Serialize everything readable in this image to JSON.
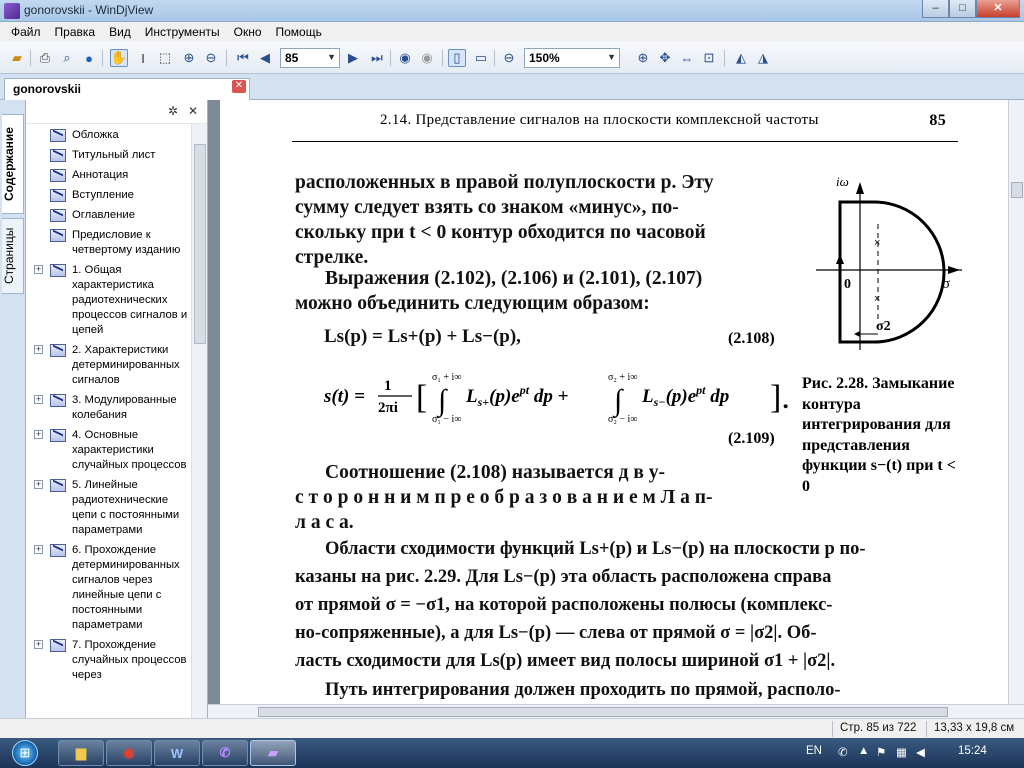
{
  "window": {
    "title": "gonorovskii - WinDjView"
  },
  "menu": [
    "Файл",
    "Правка",
    "Вид",
    "Инструменты",
    "Окно",
    "Помощь"
  ],
  "toolbar": {
    "page_value": "85",
    "zoom_value": "150%"
  },
  "doc_tab": {
    "label": "gonorovskii"
  },
  "side_tabs": {
    "contents": "Содержание",
    "pages": "Страницы"
  },
  "toc": [
    {
      "label": "Обложка",
      "expandable": false
    },
    {
      "label": "Титульный лист",
      "expandable": false
    },
    {
      "label": "Аннотация",
      "expandable": false
    },
    {
      "label": "Вступление",
      "expandable": false
    },
    {
      "label": "Оглавление",
      "expandable": false
    },
    {
      "label": "Предисловие к четвертому изданию",
      "expandable": false
    },
    {
      "label": "1. Общая характеристика радиотехнических процессов сигналов и цепей",
      "expandable": true
    },
    {
      "label": "2. Характеристики детерминированных сигналов",
      "expandable": true
    },
    {
      "label": "3. Модулированные колебания",
      "expandable": true
    },
    {
      "label": "4. Основные характеристики случайных процессов",
      "expandable": true
    },
    {
      "label": "5. Линейные радиотехнические цепи с постоянными параметрами",
      "expandable": true
    },
    {
      "label": "6. Прохождение детерминированных сигналов через линейные цепи с постоянными параметрами",
      "expandable": true
    },
    {
      "label": "7. Прохождение случайных процессов через",
      "expandable": true
    }
  ],
  "page": {
    "running_head": "2.14. Представление сигналов на плоскости комплексной частоты",
    "page_number": "85",
    "p1": [
      "расположенных в правой полуплоскости p. Эту",
      "сумму следует взять со знаком «минус», по-",
      "скольку при t < 0 контур обходится по часовой",
      "стрелке."
    ],
    "p2": [
      "Выражения (2.102), (2.106) и (2.101), (2.107)",
      "можно объединить следующим образом:"
    ],
    "eq1": "Ls(p) = Ls+(p) + Ls−(p),",
    "eq1_num": "(2.108)",
    "eq2_num": "(2.109)",
    "p3": [
      "Соотношение (2.108) называется д в у-",
      "с т о р о н н и м  п р е о б р а з о в а н и е м  Л а п-",
      "л а с а."
    ],
    "p4": [
      "Области сходимости функций Ls+(p) и Ls−(p) на плоскости p по-",
      "казаны на рис. 2.29. Для Ls−(p) эта область расположена справа",
      "от прямой σ = −σ1, на которой расположены полюсы (комплекс-",
      "но-сопряженные), а для Ls−(p) — слева от прямой σ = |σ2|. Об-",
      "ласть сходимости для Ls(p) имеет вид полосы шириной σ1 + |σ2|."
    ],
    "p5": "Путь интегрирования должен проходить по прямой, располо-",
    "figure_caption": "Рис. 2.28. Замыкание контура интегрирования для представления функции s−(t) при t < 0",
    "figure_labels": {
      "iw": "iω",
      "zero": "0",
      "sigma": "σ",
      "sigma2": "σ2"
    }
  },
  "status": {
    "page_info": "Стр. 85 из 722",
    "page_size": "13,33 х 19,8 см"
  },
  "taskbar": {
    "lang": "EN",
    "time": "15:24"
  }
}
